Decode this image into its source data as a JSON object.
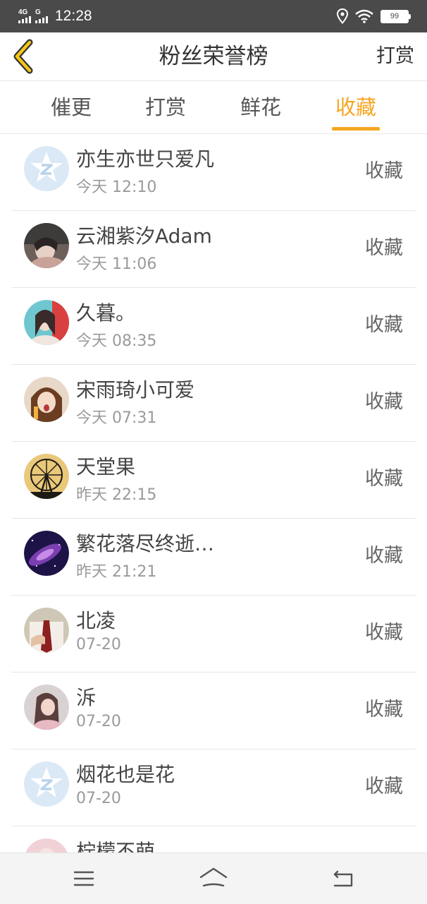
{
  "status_bar": {
    "network1": "4G",
    "network2": "G",
    "time": "12:28",
    "battery": "99",
    "icons": [
      "location-icon",
      "wifi-icon",
      "battery-icon"
    ]
  },
  "header": {
    "title": "粉丝荣誉榜",
    "right_action": "打赏",
    "back_icon": "chevron-left-icon"
  },
  "tabs": [
    {
      "label": "催更",
      "active": false
    },
    {
      "label": "打赏",
      "active": false
    },
    {
      "label": "鲜花",
      "active": false
    },
    {
      "label": "收藏",
      "active": true
    }
  ],
  "colors": {
    "accent": "#f5a623",
    "status_bar": "#4a4a4a"
  },
  "list": [
    {
      "name": "亦生亦世只爱凡",
      "time": "今天 12:10",
      "action": "收藏",
      "avatar": "default-qq-avatar"
    },
    {
      "name": "云湘紫汐Adam",
      "time": "今天 11:06",
      "action": "收藏",
      "avatar": "user-photo"
    },
    {
      "name": "久暮。",
      "time": "今天 08:35",
      "action": "收藏",
      "avatar": "user-photo"
    },
    {
      "name": "宋雨琦小可爱",
      "time": "今天 07:31",
      "action": "收藏",
      "avatar": "user-photo"
    },
    {
      "name": "天堂果",
      "time": "昨天 22:15",
      "action": "收藏",
      "avatar": "ferris-wheel-photo"
    },
    {
      "name": "繁花落尽终逝…",
      "time": "昨天 21:21",
      "action": "收藏",
      "avatar": "galaxy-photo"
    },
    {
      "name": "北凌",
      "time": "07-20",
      "action": "收藏",
      "avatar": "user-photo"
    },
    {
      "name": "泝",
      "time": "07-20",
      "action": "收藏",
      "avatar": "user-photo"
    },
    {
      "name": "烟花也是花",
      "time": "07-20",
      "action": "收藏",
      "avatar": "default-qq-avatar"
    },
    {
      "name": "柠檬不萌",
      "time": "",
      "action": "",
      "avatar": "user-photo"
    }
  ],
  "navbar": {
    "icons": [
      "menu-icon",
      "home-icon",
      "back-icon"
    ]
  }
}
